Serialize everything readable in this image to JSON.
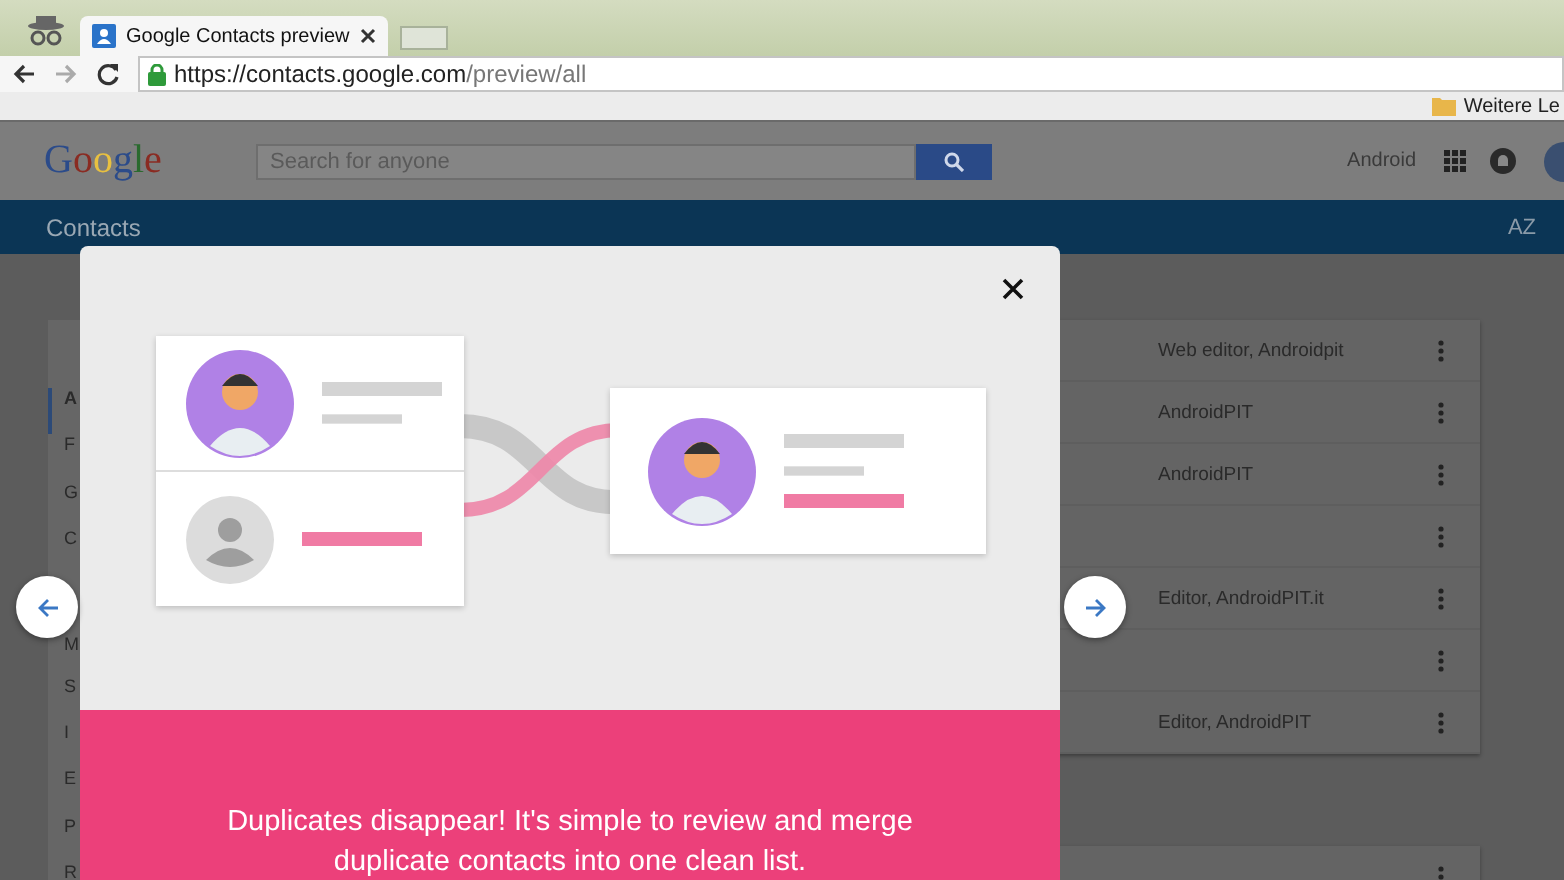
{
  "browser": {
    "tabs": [
      {
        "title": "Google Contacts preview",
        "selected": true
      }
    ],
    "address": {
      "host": "https://contacts.google.com",
      "path": "/preview/all"
    },
    "bookmarks": [
      {
        "label": "Weitere Le"
      }
    ]
  },
  "header": {
    "logo": "Google",
    "search": {
      "placeholder": "Search for anyone"
    },
    "account_label": "Android"
  },
  "app_bar": {
    "title": "Contacts",
    "sort_label": "AZ"
  },
  "sidebar": {
    "items": [
      {
        "label": "A",
        "selected": true
      },
      {
        "label": "F",
        "selected": false
      },
      {
        "label": "G",
        "selected": false
      },
      {
        "label": "C",
        "selected": false
      },
      {
        "label": "M",
        "selected": false
      },
      {
        "label": "S",
        "selected": false
      },
      {
        "label": "I",
        "selected": false
      },
      {
        "label": "E",
        "selected": false
      },
      {
        "label": "P",
        "selected": false
      },
      {
        "label": "R",
        "selected": false
      }
    ]
  },
  "contacts": {
    "rows": [
      {
        "column_2": "Web editor, Androidpit"
      },
      {
        "column_2": "AndroidPIT"
      },
      {
        "column_2": "AndroidPIT"
      },
      {},
      {
        "column_2": "Editor, AndroidPIT.it"
      },
      {},
      {
        "column_2": "Editor, AndroidPIT"
      }
    ],
    "second_card_rows": [
      {}
    ]
  },
  "dialog": {
    "message": "Duplicates disappear! It's simple to review and merge duplicate contacts into one clean list."
  }
}
